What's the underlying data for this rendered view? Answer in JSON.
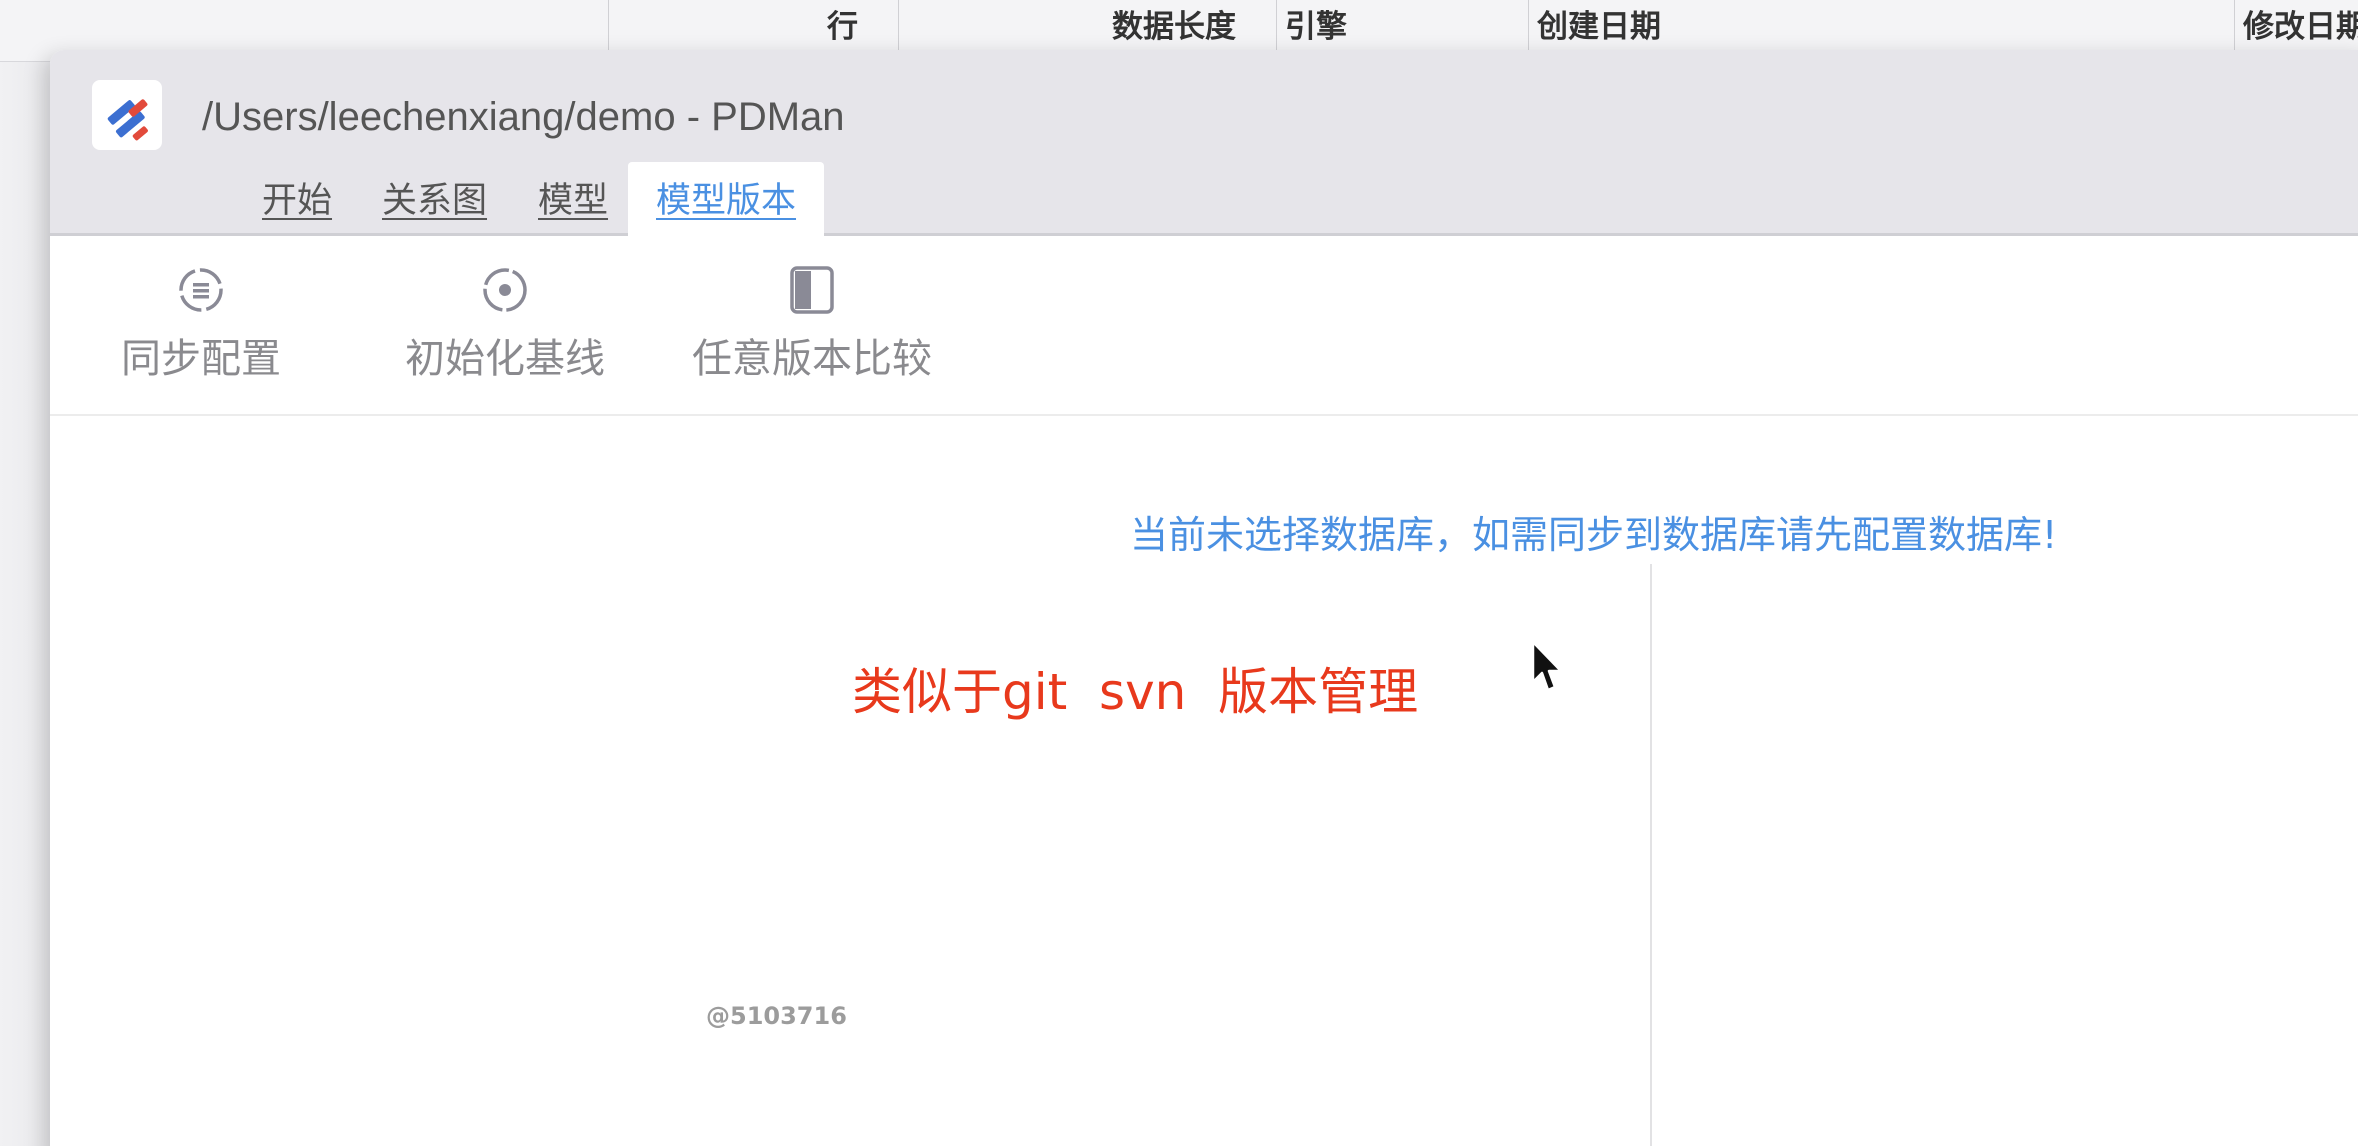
{
  "background_window": {
    "columns": [
      "行",
      "数据长度",
      "引擎",
      "创建日期",
      "修改日期"
    ]
  },
  "window": {
    "title": "/Users/leechenxiang/demo - PDMan",
    "logo_icon": "pdman-logo-icon"
  },
  "menu": {
    "tabs": [
      {
        "label": "开始",
        "active": false
      },
      {
        "label": "关系图",
        "active": false
      },
      {
        "label": "模型",
        "active": false
      },
      {
        "label": "模型版本",
        "active": true
      }
    ]
  },
  "toolbar": {
    "buttons": [
      {
        "label": "同步配置",
        "icon": "sync-config-icon"
      },
      {
        "label": "初始化基线",
        "icon": "init-baseline-icon"
      },
      {
        "label": "任意版本比较",
        "icon": "compare-versions-icon"
      }
    ]
  },
  "content": {
    "notice": "当前未选择数据库，如需同步到数据库请先配置数据库!",
    "annotation": "类似于git  svn  版本管理",
    "watermark": "@5103716"
  },
  "colors": {
    "accent": "#4a90e2",
    "annotation": "#e8391c",
    "titlebar": "#e6e5ea"
  }
}
